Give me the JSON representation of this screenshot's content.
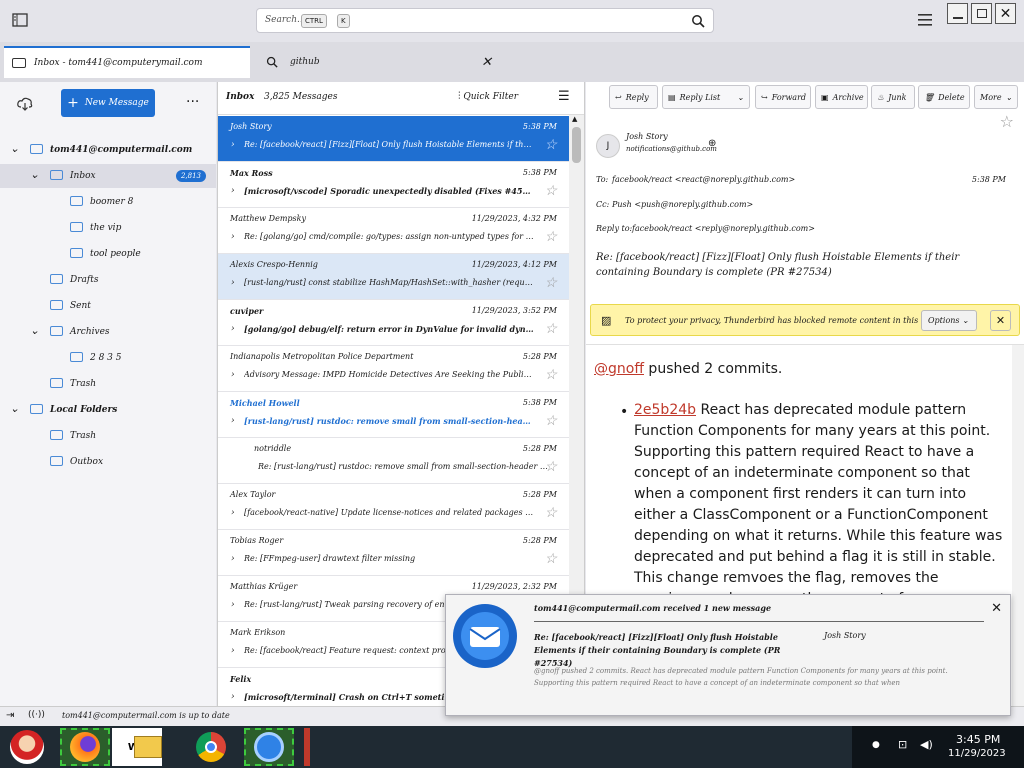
{
  "titlebar": {
    "search_placeholder": "Search...",
    "kbd1": "CTRL",
    "kbd2": "K"
  },
  "tabs": [
    {
      "label": "Inbox - tom441@computerymail.com"
    },
    {
      "label": "github"
    }
  ],
  "folder_pane": {
    "new_message": "New Message",
    "folders": [
      {
        "name": "tom441@computermail.com",
        "level": 0
      },
      {
        "name": "Inbox",
        "level": 1,
        "badge": "2,813"
      },
      {
        "name": "boomer 8",
        "level": 2
      },
      {
        "name": "the vip",
        "level": 2
      },
      {
        "name": "tool people",
        "level": 2
      },
      {
        "name": "Drafts",
        "level": 1
      },
      {
        "name": "Sent",
        "level": 1
      },
      {
        "name": "Archives",
        "level": 1
      },
      {
        "name": "2 8 3 5",
        "level": 2
      },
      {
        "name": "Trash",
        "level": 1
      },
      {
        "name": "Local Folders",
        "level": 0
      },
      {
        "name": "Trash",
        "level": 1
      },
      {
        "name": "Outbox",
        "level": 1
      }
    ]
  },
  "list": {
    "folder": "Inbox",
    "count": "3,825 Messages",
    "quick_filter": "Quick Filter",
    "messages": [
      {
        "from": "Josh Story",
        "date": "5:38 PM",
        "subject": "Re: [facebook/react] [Fizz][Float] Only flush Hoistable Elements if their containing Boundary is complete",
        "state": "sel"
      },
      {
        "from": "Max Ross",
        "date": "5:38 PM",
        "subject": "[microsoft/vscode] Sporadic unexpectedly disabled (Fixes #4567)",
        "state": "unread"
      },
      {
        "from": "Matthew Dempsky",
        "date": "11/29/2023, 4:32 PM",
        "subject": "Re: [golang/go] cmd/compile: go/types: assign non-untyped types for all untime or",
        "state": ""
      },
      {
        "from": "Alexis Crespo-Hennig",
        "date": "11/29/2023, 4:12 PM",
        "subject": "[rust-lang/rust] const stabilize HashMap/HashSet::with_hasher (required co",
        "state": "hl"
      },
      {
        "from": "cuviper",
        "date": "11/29/2023, 3:52 PM",
        "subject": "[golang/go] debug/elf: return error in DynValue for invalid dynamic section",
        "state": "unread"
      },
      {
        "from": "Indianapolis Metropolitan Police Department",
        "date": "5:28 PM",
        "subject": "Advisory Message: IMPD Homicide Detectives Are Seeking the Public's",
        "state": ""
      },
      {
        "from": "Michael Howell",
        "date": "5:38 PM",
        "subject": "[rust-lang/rust] rustdoc: remove small from small-section-header (PR",
        "state": "unread blue"
      },
      {
        "from": "notriddle",
        "date": "5:28 PM",
        "subject": "Re: [rust-lang/rust] rustdoc: remove small from small-section-header (PR",
        "state": "child"
      },
      {
        "from": "Alex Taylor",
        "date": "5:28 PM",
        "subject": "[facebook/react-native] Update license-notices and related packages in prereqs",
        "state": ""
      },
      {
        "from": "Tobias Roger",
        "date": "5:28 PM",
        "subject": "Re: [FFmpeg-user] drawtext filter missing",
        "state": ""
      },
      {
        "from": "Matthias Krüger",
        "date": "11/29/2023, 2:32 PM",
        "subject": "Re: [rust-lang/rust] Tweak parsing recovery of enums, for exprs and",
        "state": ""
      },
      {
        "from": "Mark Erikson",
        "date": "11/29/2023, 2:42 PM",
        "subject": "Re: [facebook/react] Feature request: context propagation",
        "state": ""
      },
      {
        "from": "Felix",
        "date": "",
        "subject": "[microsoft/terminal] Crash on Ctrl+T sometimes at start",
        "state": "unread"
      }
    ]
  },
  "reader": {
    "toolbar": [
      "Reply",
      "Reply List",
      "Forward",
      "Archive",
      "Junk",
      "Delete",
      "More"
    ],
    "from_name": "Josh Story",
    "from_addr": "notifications@github.com",
    "avatar": "J",
    "to_label": "To:",
    "to": "facebook/react <react@noreply.github.com>",
    "date": "5:38 PM",
    "cc_label": "Cc:",
    "cc": "Push <push@noreply.github.com>",
    "reply_label": "Reply to:",
    "reply_to": "facebook/react <reply@noreply.github.com>",
    "subject": "Re: [facebook/react] [Fizz][Float] Only flush Hoistable Elements if their containing Boundary is complete (PR #27534)",
    "remote_text": "To protect your privacy, Thunderbird has blocked remote content in this message.",
    "options": "Options",
    "body_author": "@gnoff",
    "body_intro": " pushed 2 commits.",
    "commit_hash": "2e5b24b",
    "commit_text": " React has deprecated module pattern Function Components for many years at this point. Supporting this pattern required React to have a concept of an indeterminate component so that when a component first renders it can turn into either a ClassComponent or a FunctionComponent depending on what it returns. While this feature was deprecated and put behind a flag it is still in stable. This change remvoes the flag, removes the warnings, and removes the concept of"
  },
  "statusbar": {
    "text": "tom441@computermail.com is up to date"
  },
  "toast": {
    "title": "tom441@computermail.com received 1 new message",
    "subject": "Re: [facebook/react] [Fizz][Float] Only flush Hoistable Elements if their containing Boundary is complete (PR #27534)",
    "from": "Josh Story",
    "preview": "@gnoff pushed 2 commits. React has deprecated module pattern Function Components for many years at this point. Supporting this pattern required React to have a concept of an indeterminate component so that when"
  },
  "taskbar": {
    "time": "3:45 PM",
    "date": "11/29/2023"
  },
  "colors": {
    "accent": "#1f6fd1",
    "taskbar": "#1f2a33"
  }
}
